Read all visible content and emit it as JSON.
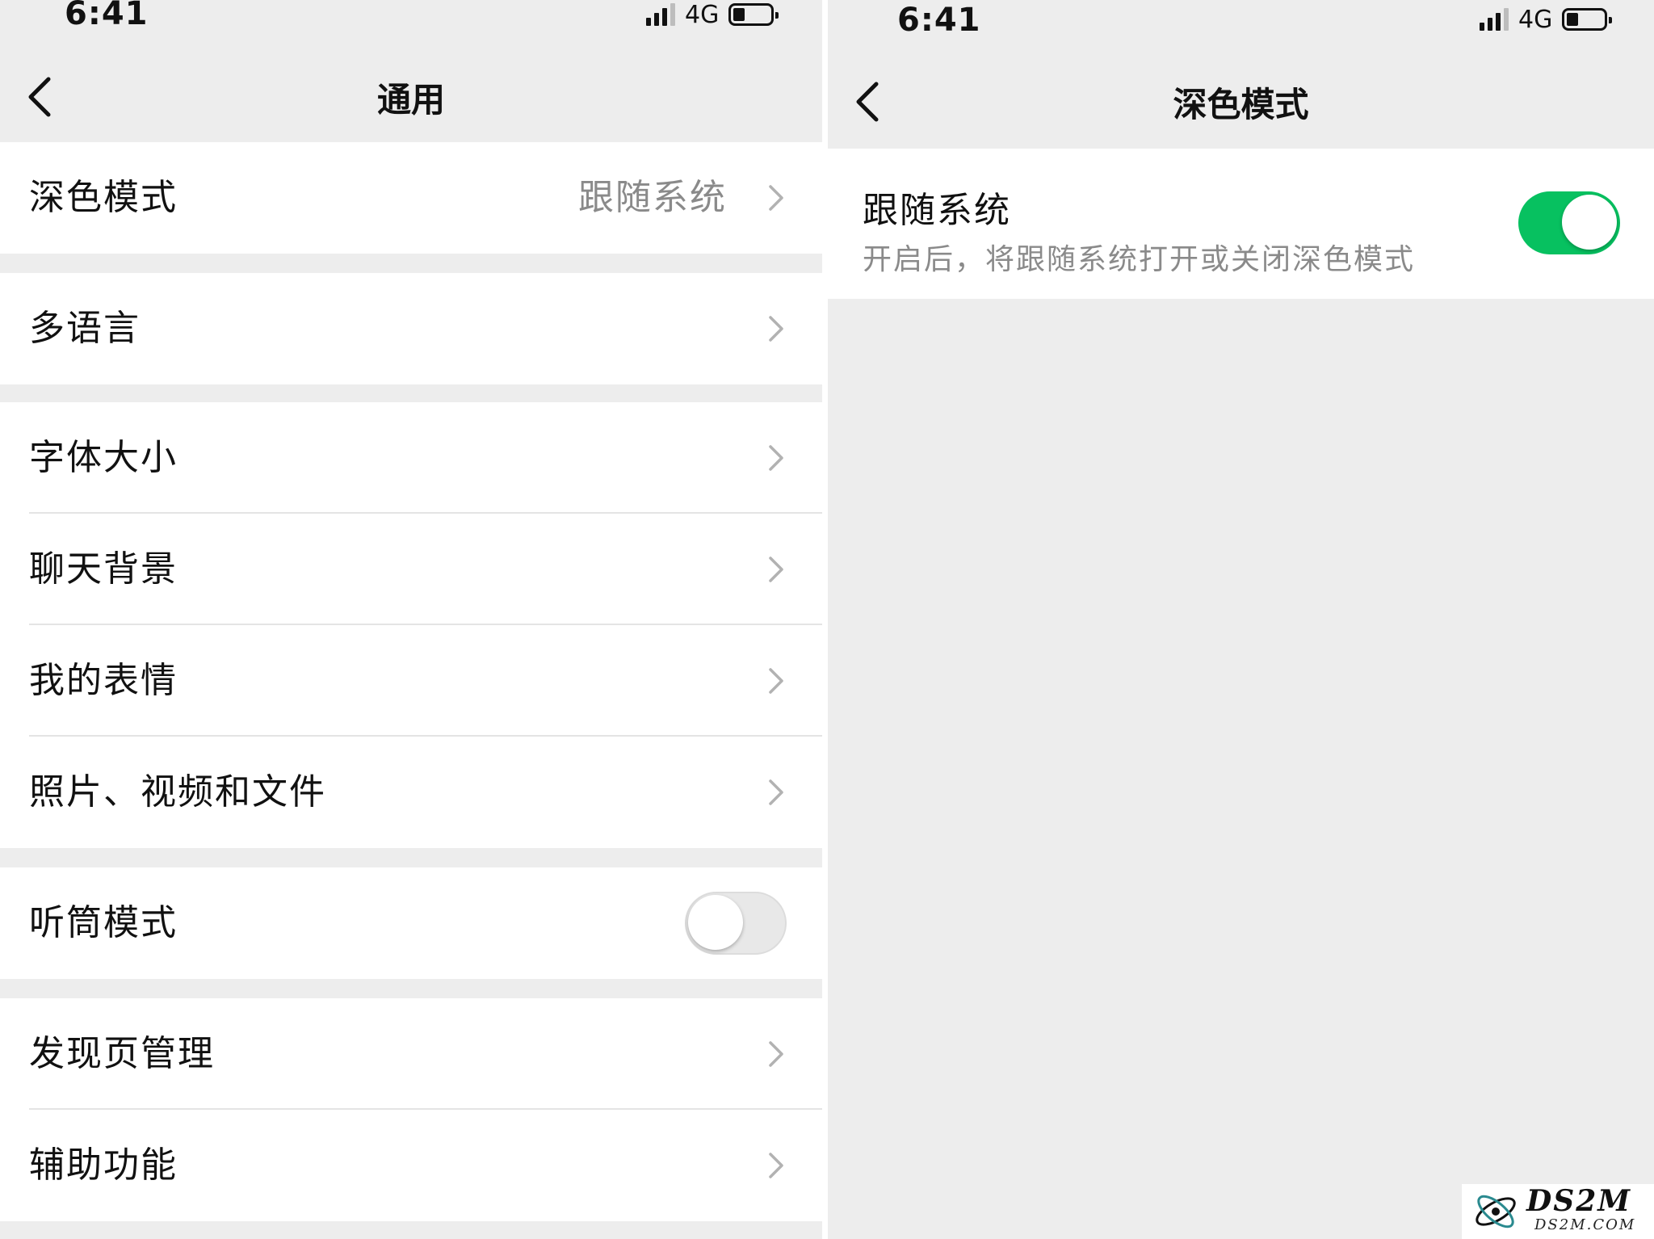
{
  "left_screen": {
    "status": {
      "time": "6:41",
      "network": "4G"
    },
    "nav": {
      "title": "通用"
    },
    "groups": [
      {
        "cells": [
          {
            "label": "深色模式",
            "value": "跟随系统"
          }
        ]
      },
      {
        "cells": [
          {
            "label": "多语言"
          }
        ]
      },
      {
        "cells": [
          {
            "label": "字体大小"
          },
          {
            "label": "聊天背景"
          },
          {
            "label": "我的表情"
          },
          {
            "label": "照片、视频和文件"
          }
        ]
      },
      {
        "cells": [
          {
            "label": "听筒模式",
            "toggle": "off"
          }
        ]
      },
      {
        "cells": [
          {
            "label": "发现页管理"
          },
          {
            "label": "辅助功能"
          }
        ]
      }
    ]
  },
  "right_screen": {
    "status": {
      "time": "6:41",
      "network": "4G"
    },
    "nav": {
      "title": "深色模式"
    },
    "follow_system": {
      "label": "跟随系统",
      "description": "开启后，将跟随系统打开或关闭深色模式",
      "toggle": "on"
    }
  },
  "watermark": {
    "name": "DS2M",
    "domain": "DS2M.COM"
  },
  "colors": {
    "toggle_on": "#07c160",
    "background": "#ededed",
    "secondary_text": "#8a8a8a"
  },
  "icons": [
    "back-chevron-icon",
    "chevron-right-icon",
    "signal-icon",
    "battery-icon"
  ]
}
